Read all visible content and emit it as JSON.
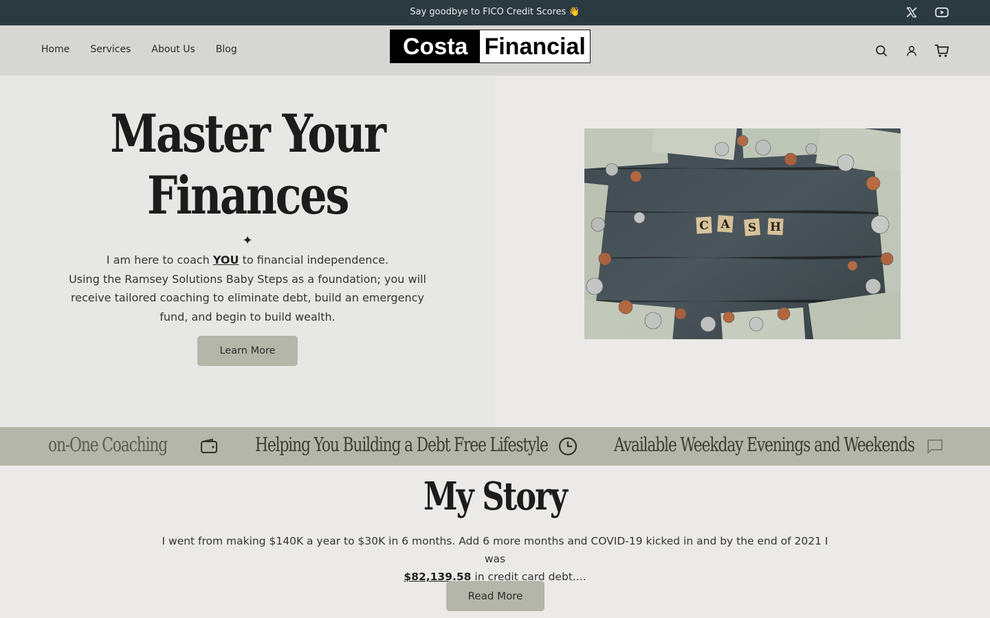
{
  "announcement": {
    "message": "Say goodbye to FICO Credit Scores 👋",
    "social": [
      "x-icon",
      "youtube-icon"
    ]
  },
  "header": {
    "nav": [
      "Home",
      "Services",
      "About Us",
      "Blog"
    ],
    "logo": {
      "part1": "Costa",
      "part2": "Financial"
    },
    "icons": [
      "search-icon",
      "user-icon",
      "cart-icon"
    ]
  },
  "hero": {
    "title_line1": "Master Your",
    "title_line2": "Finances",
    "sparkle": "✦",
    "text_before_you": "I am here to coach ",
    "you": "YOU",
    "text_after_you": " to financial independence.",
    "paragraph": "Using the Ramsey Solutions Baby Steps as a foundation; you will receive tailored coaching to eliminate debt, build an emergency fund, and begin to build wealth.",
    "button": "Learn More",
    "image_letters": [
      "C",
      "A",
      "S",
      "H"
    ]
  },
  "marquee": {
    "items": [
      "on-One Coaching",
      "Helping You Building a Debt Free Lifestyle",
      "Available Weekday Evenings and Weekends"
    ],
    "icons": [
      "wallet-icon",
      "clock-icon",
      "chat-icon"
    ]
  },
  "story": {
    "title": "My Story",
    "text_before": "I went from making $140K a year to $30K in 6 months. Add 6 more months and COVID-19 kicked in and by the end of 2021 I was",
    "amount": "$82,139.58",
    "text_after": " in credit card debt....",
    "button": "Read More"
  },
  "colors": {
    "announcement_bg": "#2b3a40",
    "header_bg": "#d6d6d4",
    "accent": "#b3b6a8",
    "page_bg": "#ebeae8"
  }
}
